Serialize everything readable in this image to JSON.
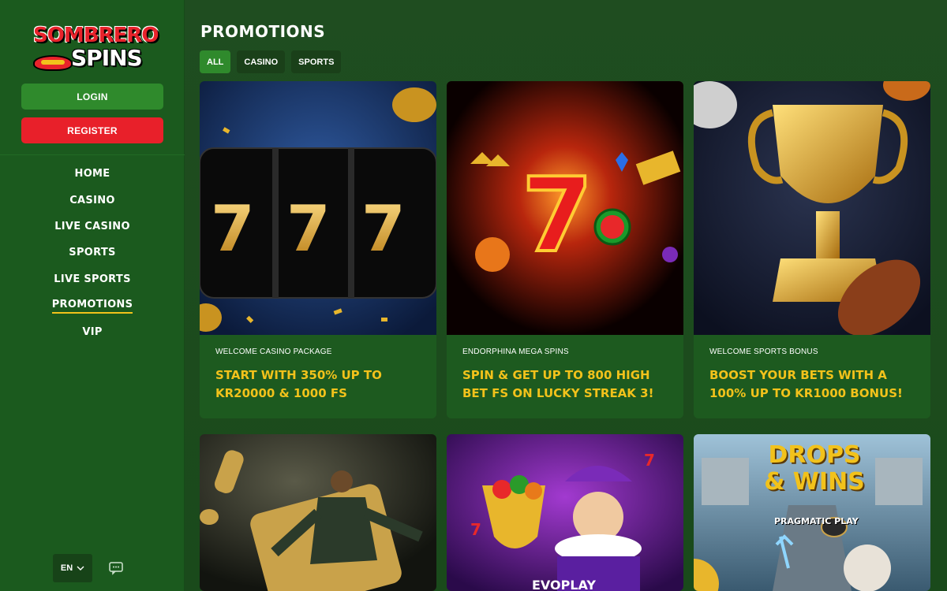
{
  "brand": {
    "logo_line1": "SOMBRERO",
    "logo_line2": "SPINS",
    "accent_green": "#2f8a2c",
    "accent_red": "#e8202a",
    "accent_yellow": "#f2c21b"
  },
  "auth": {
    "login_label": "LOGIN",
    "register_label": "REGISTER"
  },
  "nav": {
    "items": [
      {
        "label": "HOME"
      },
      {
        "label": "CASINO"
      },
      {
        "label": "LIVE CASINO"
      },
      {
        "label": "SPORTS"
      },
      {
        "label": "LIVE SPORTS"
      },
      {
        "label": "PROMOTIONS",
        "active": true
      },
      {
        "label": "VIP"
      }
    ]
  },
  "footer": {
    "language": "EN",
    "chat_icon": "chat-icon"
  },
  "page": {
    "title": "PROMOTIONS",
    "filters": [
      {
        "label": "ALL",
        "active": true
      },
      {
        "label": "CASINO"
      },
      {
        "label": "SPORTS"
      }
    ]
  },
  "promotions": [
    {
      "subtitle": "WELCOME CASINO PACKAGE",
      "title": "START WITH 350% UP TO KR20000 & 1000 FS",
      "art": "slot-777-reels"
    },
    {
      "subtitle": "ENDORPHINA MEGA SPINS",
      "title": "SPIN & GET UP TO 800 HIGH BET FS ON LUCKY STREAK 3!",
      "art": "lucky-seven"
    },
    {
      "subtitle": "WELCOME SPORTS BONUS",
      "title": "BOOST YOUR BETS WITH A 100% UP TO KR1000 BONUS!",
      "art": "gold-trophy"
    },
    {
      "art": "football-player"
    },
    {
      "art": "jester",
      "art_label": "EVOPLAY"
    },
    {
      "art": "drops-wins",
      "art_label": "DROPS & WINS",
      "art_sublabel": "PRAGMATIC PLAY"
    }
  ]
}
